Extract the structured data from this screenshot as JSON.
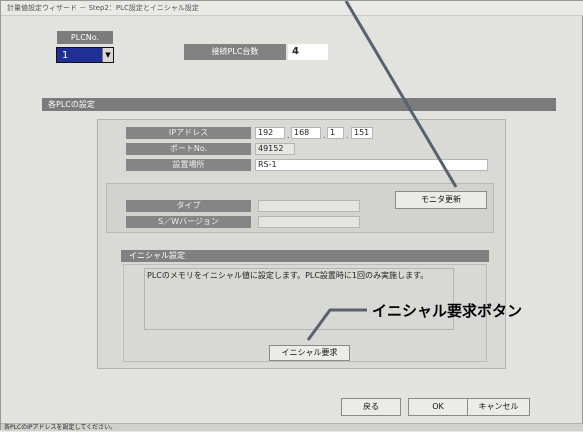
{
  "window": {
    "title": "計量値設定ウィザード － Step2：PLC設定とイニシャル設定",
    "status": "各PLCのIPアドレスを設定してください。"
  },
  "plc": {
    "label": "PLCNo.",
    "selected": "1",
    "count_label": "接続PLC台数",
    "count_value": "4"
  },
  "section": {
    "title": "各PLCの設定",
    "ip_label": "IPアドレス",
    "ip": [
      "192",
      "168",
      "1",
      "151"
    ],
    "port_label": "ポートNo.",
    "port": "49152",
    "location_label": "設置場所",
    "location": "RS-1",
    "monitor_button": "モニタ更新",
    "type_label": "タイプ",
    "type_value": "",
    "sw_label": "S／Wバージョン",
    "sw_value": ""
  },
  "initial": {
    "title": "イニシャル設定",
    "description": "PLCのメモリをイニシャル値に設定します。PLC設置時に1回のみ実施します。",
    "button": "イニシャル要求"
  },
  "annotation": {
    "text": "イニシャル要求ボタン"
  },
  "footer": {
    "back": "戻る",
    "ok": "OK",
    "cancel": "キャンセル"
  }
}
